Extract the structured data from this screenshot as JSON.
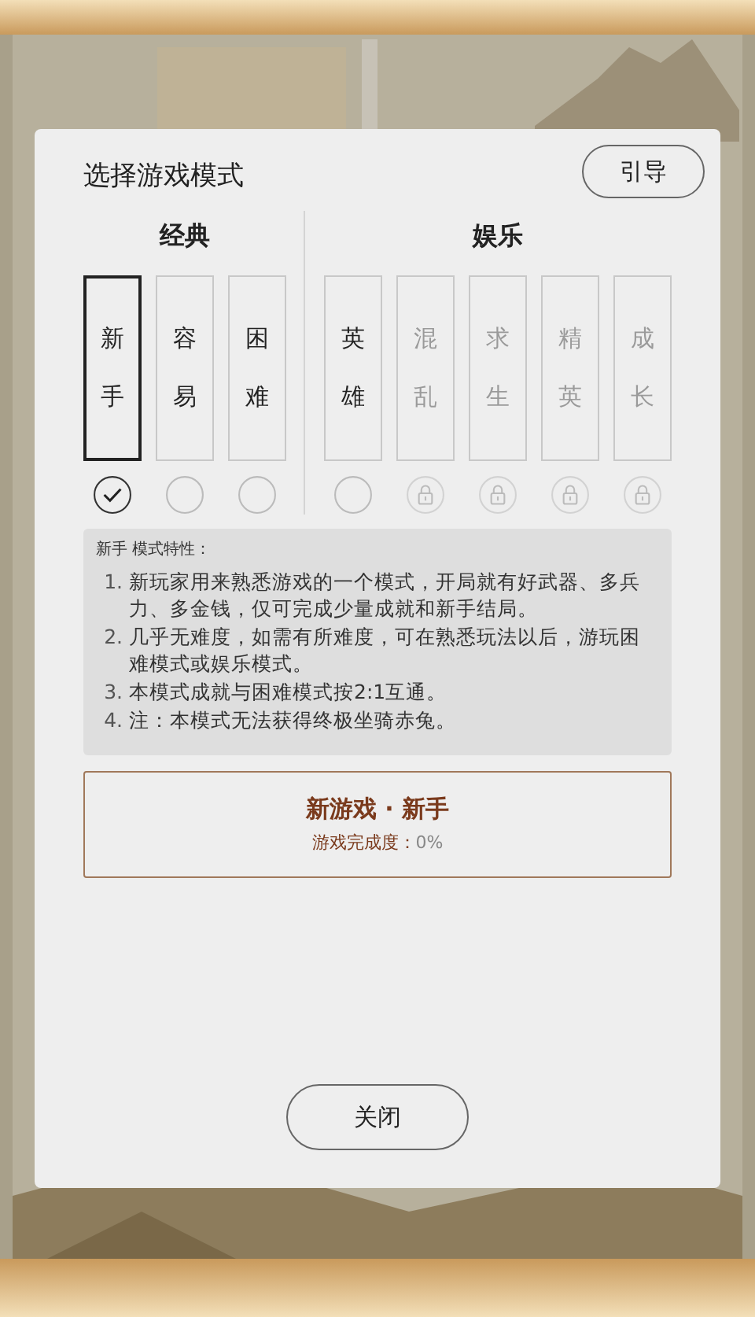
{
  "dialog": {
    "title": "选择游戏模式",
    "guide_button": "引导",
    "groups": [
      {
        "title": "经典",
        "modes": [
          {
            "label": "新手",
            "selected": true,
            "locked": false
          },
          {
            "label": "容易",
            "selected": false,
            "locked": false
          },
          {
            "label": "困难",
            "selected": false,
            "locked": false
          }
        ]
      },
      {
        "title": "娱乐",
        "modes": [
          {
            "label": "英雄",
            "selected": false,
            "locked": false
          },
          {
            "label": "混乱",
            "selected": false,
            "locked": true
          },
          {
            "label": "求生",
            "selected": false,
            "locked": true
          },
          {
            "label": "精英",
            "selected": false,
            "locked": true
          },
          {
            "label": "成长",
            "selected": false,
            "locked": true
          }
        ]
      }
    ],
    "description": {
      "heading": "新手 模式特性：",
      "items": [
        {
          "number": "1.",
          "text": "新玩家用来熟悉游戏的一个模式，开局就有好武器、多兵力、多金钱，仅可完成少量成就和新手结局。"
        },
        {
          "number": "2.",
          "text": "几乎无难度，如需有所难度，可在熟悉玩法以后，游玩困难模式或娱乐模式。"
        },
        {
          "number": "3.",
          "text": "本模式成就与困难模式按2:1互通。"
        },
        {
          "number": "4.",
          "text": "注：本模式无法获得终极坐骑赤兔。"
        }
      ]
    },
    "start_button": {
      "title": "新游戏 · 新手",
      "progress_label": "游戏完成度：",
      "progress_value": "0%"
    },
    "close_button": "关闭"
  }
}
